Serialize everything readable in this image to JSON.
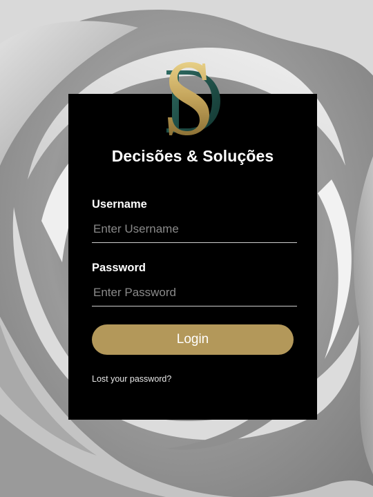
{
  "brand": {
    "name": "Decisões & Soluções",
    "logo_letters": "DS",
    "colors": {
      "gold": "#b3985a",
      "teal": "#1f4f48",
      "card": "#000000"
    }
  },
  "form": {
    "username": {
      "label": "Username",
      "placeholder": "Enter Username",
      "value": ""
    },
    "password": {
      "label": "Password",
      "placeholder": "Enter Password",
      "value": ""
    },
    "login_label": "Login",
    "lost_password_label": "Lost your password?"
  },
  "background": {
    "subject": "grayscale rose petals"
  }
}
